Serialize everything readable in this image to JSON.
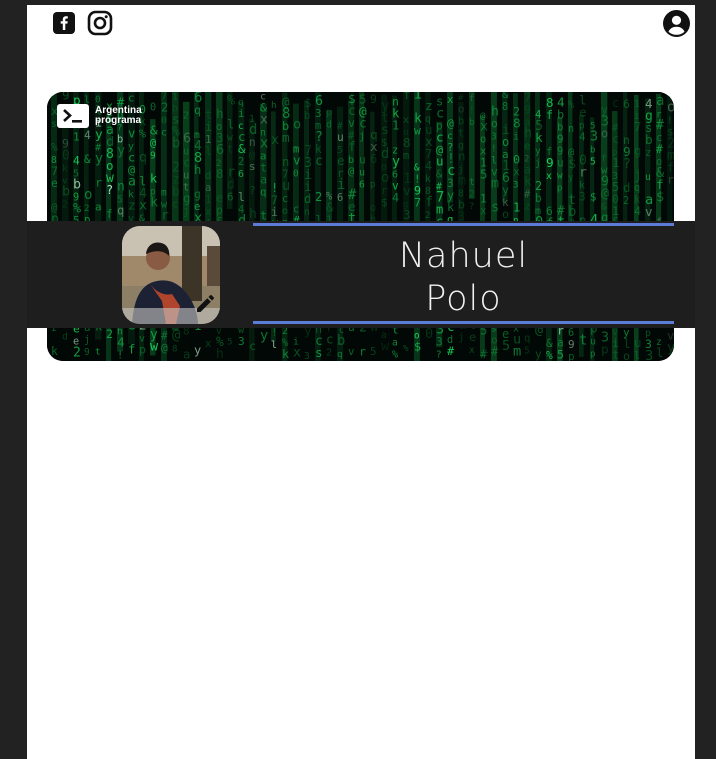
{
  "header": {
    "social_links": [
      {
        "icon": "facebook-icon",
        "label": "Facebook"
      },
      {
        "icon": "instagram-icon",
        "label": "Instagram"
      }
    ],
    "user_icon": "user-circle-icon"
  },
  "banner": {
    "logo": {
      "line1": "Argentina",
      "line2": "programa"
    }
  },
  "profile": {
    "first_name": "Nahuel",
    "last_name": "Polo",
    "edit_icon": "pencil-icon"
  },
  "colors": {
    "page_bg": "#222222",
    "namebar_bg": "#1e1e1e",
    "accent_line": "#5b7bd6",
    "matrix_green": "#19d35a"
  }
}
